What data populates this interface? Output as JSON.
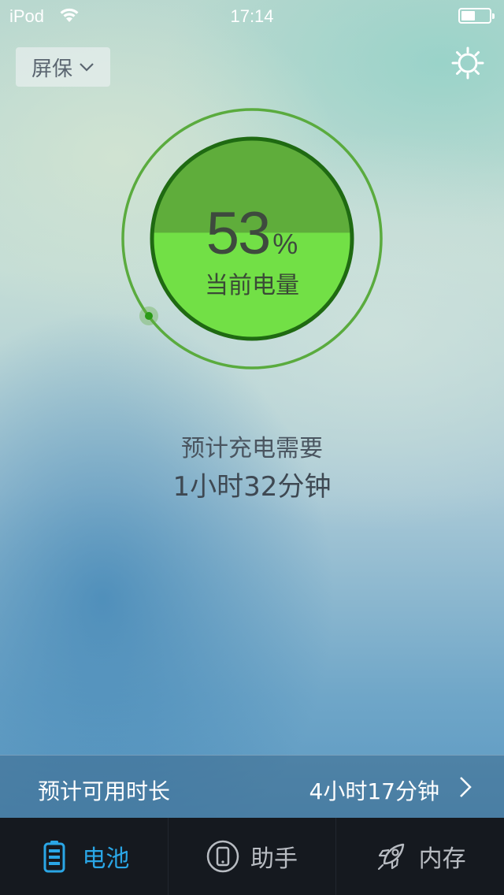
{
  "status_bar": {
    "carrier": "iPod",
    "time": "17:14",
    "battery_level": 0.5
  },
  "header": {
    "saver_label": "屏保",
    "saver_icon": "chevron-down-icon",
    "settings_icon": "gear-icon"
  },
  "gauge": {
    "percent": "53",
    "percent_sign": "%",
    "label": "当前电量",
    "level": 0.53,
    "colors": {
      "ring": "#5aab3e",
      "upper": "#5fad3b",
      "lower": "#72e046",
      "border": "#1f6a12"
    }
  },
  "charge": {
    "label": "预计充电需要",
    "time": "1小时32分钟"
  },
  "usage": {
    "label": "预计可用时长",
    "value": "4小时17分钟"
  },
  "tabs": [
    {
      "label": "电池",
      "icon": "battery-icon",
      "active": true
    },
    {
      "label": "助手",
      "icon": "phone-icon",
      "active": false
    },
    {
      "label": "内存",
      "icon": "rocket-icon",
      "active": false
    }
  ],
  "colors": {
    "accent": "#2aa6e6",
    "tab_bar": "#15191f"
  }
}
